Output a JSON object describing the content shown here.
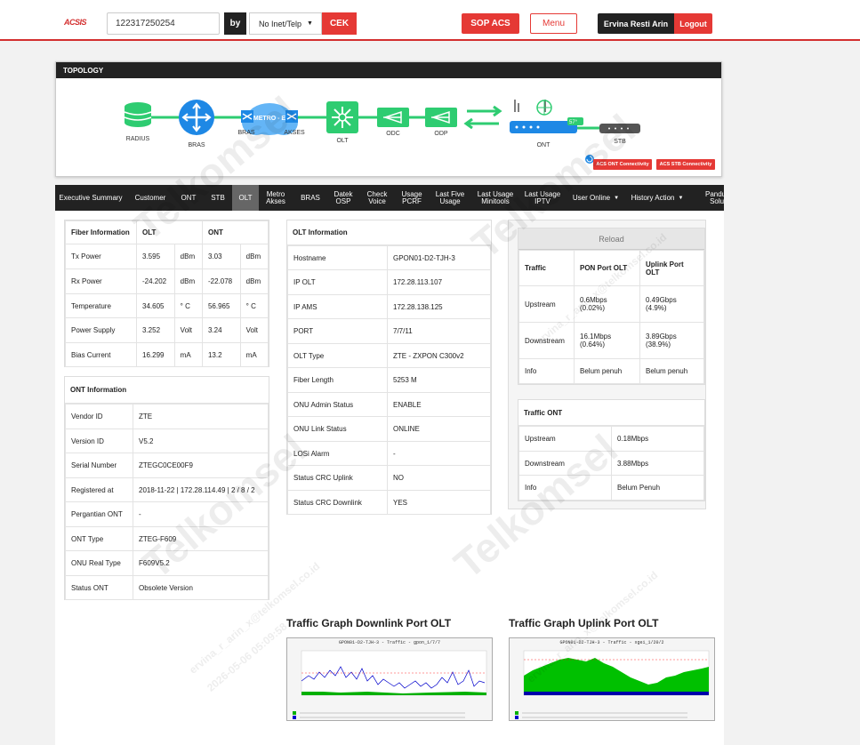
{
  "header": {
    "logo": "ACSIS",
    "search_value": "122317250254",
    "by_label": "by",
    "select_value": "No Inet/Telp",
    "cek_label": "CEK",
    "sop_label": "SOP ACS",
    "menu_label": "Menu",
    "user_name": "Ervina Resti Arin",
    "logout_label": "Logout"
  },
  "topology": {
    "title": "TOPOLOGY",
    "nodes": {
      "radius": "RADIUS",
      "bras": "BRAS",
      "bras2": "BRAS",
      "metro": "METRO - E",
      "akses": "AKSES",
      "olt": "OLT",
      "odc": "ODC",
      "odp": "ODP",
      "ont": "ONT",
      "stb": "STB"
    },
    "ont_badge": "57°",
    "acs_ont_label": "ACS ONT Connectivity",
    "acs_stb_label": "ACS STB Connectivity",
    "colors": {
      "green": "#2ecc71",
      "blue": "#1e88e5",
      "red": "#e53935"
    }
  },
  "nav": {
    "items": [
      "Executive Summary",
      "Customer",
      "ONT",
      "STB",
      "OLT",
      "Metro Akses",
      "BRAS",
      "Datek OSP",
      "Check Voice",
      "Usage PCRF",
      "Last Five Usage",
      "Last Usage Minitools",
      "Last Usage IPTV",
      "User Online",
      "History Action",
      "Panduan Solusi"
    ],
    "active": "OLT"
  },
  "fiber": {
    "headers": [
      "Fiber Information",
      "OLT",
      "",
      "ONT",
      ""
    ],
    "rows": [
      [
        "Tx Power",
        "3.595",
        "dBm",
        "3.03",
        "dBm"
      ],
      [
        "Rx Power",
        "-24.202",
        "dBm",
        "-22.078",
        "dBm"
      ],
      [
        "Temperature",
        "34.605",
        "° C",
        "56.965",
        "° C"
      ],
      [
        "Power Supply",
        "3.252",
        "Volt",
        "3.24",
        "Volt"
      ],
      [
        "Bias Current",
        "16.299",
        "mA",
        "13.2",
        "mA"
      ]
    ]
  },
  "ont_info": {
    "title": "ONT Information",
    "rows": [
      [
        "Vendor ID",
        "ZTE"
      ],
      [
        "Version ID",
        "V5.2"
      ],
      [
        "Serial Number",
        "ZTEGC0CE00F9"
      ],
      [
        "Registered at",
        "2018-11-22 | 172.28.114.49 | 2 / 8 / 2"
      ],
      [
        "Pergantian ONT",
        "-"
      ],
      [
        "ONT Type",
        "ZTEG-F609"
      ],
      [
        "ONU Real Type",
        "F609V5.2"
      ],
      [
        "Status ONT",
        "Obsolete Version"
      ]
    ]
  },
  "olt_info": {
    "title": "OLT Information",
    "rows": [
      [
        "Hostname",
        "GPON01-D2-TJH-3"
      ],
      [
        "IP OLT",
        "172.28.113.107"
      ],
      [
        "IP AMS",
        "172.28.138.125"
      ],
      [
        "PORT",
        "7/7/11"
      ],
      [
        "OLT Type",
        "ZTE - ZXPON C300v2"
      ],
      [
        "Fiber Length",
        "5253 M"
      ],
      [
        "ONU Admin Status",
        "ENABLE"
      ],
      [
        "ONU Link Status",
        "ONLINE"
      ],
      [
        "LOSi Alarm",
        "-"
      ],
      [
        "Status CRC Uplink",
        "NO"
      ],
      [
        "Status CRC Downlink",
        "YES"
      ]
    ]
  },
  "traffic": {
    "reload_label": "Reload",
    "headers": [
      "Traffic",
      "PON Port OLT",
      "Uplink Port OLT"
    ],
    "rows": [
      [
        "Upstream",
        "0.6Mbps",
        "(0.02%)",
        "0.49Gbps",
        "(4.9%)"
      ],
      [
        "Downstream",
        "16.1Mbps",
        "(0.64%)",
        "3.89Gbps",
        "(38.9%)"
      ],
      [
        "Info",
        "Belum penuh",
        "",
        "Belum penuh",
        ""
      ]
    ]
  },
  "traffic_ont": {
    "title": "Traffic ONT",
    "rows": [
      [
        "Upstream",
        "0.18Mbps"
      ],
      [
        "Downstream",
        "3.88Mbps"
      ],
      [
        "Info",
        "Belum Penuh"
      ]
    ]
  },
  "graphs": {
    "downlink_title": "Traffic Graph Downlink Port OLT",
    "uplink_title": "Traffic Graph Uplink Port OLT",
    "downlink_caption": "GPON01-D2-TJH-3 - Traffic - gpon_1/7/7",
    "uplink_caption": "GPON01-D2-TJH-3 - Traffic - xgei_1/20/2"
  },
  "watermark": {
    "brand": "Telkomsel",
    "user": "ervina_r_arin_x@telkomsel.co.id",
    "stamp": "2026-05-06 05:09:58"
  }
}
